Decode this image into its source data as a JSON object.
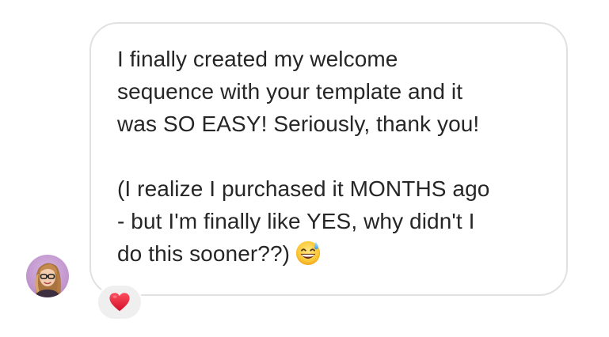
{
  "message": {
    "paragraph_1": "I finally created my welcome\nsequence with your template and it\nwas SO EASY! Seriously, thank you!",
    "paragraph_2": "(I realize I purchased it MONTHS ago\n- but I'm finally like YES, why didn't I\ndo this sooner??)",
    "emoji": "grinning-face-with-sweat-icon",
    "bubble_border_color": "#e1e1e1",
    "text_color": "#262626"
  },
  "sender": {
    "avatar": "avatar"
  },
  "reaction": {
    "icon": "red-heart-icon",
    "color": "#e0245e"
  }
}
